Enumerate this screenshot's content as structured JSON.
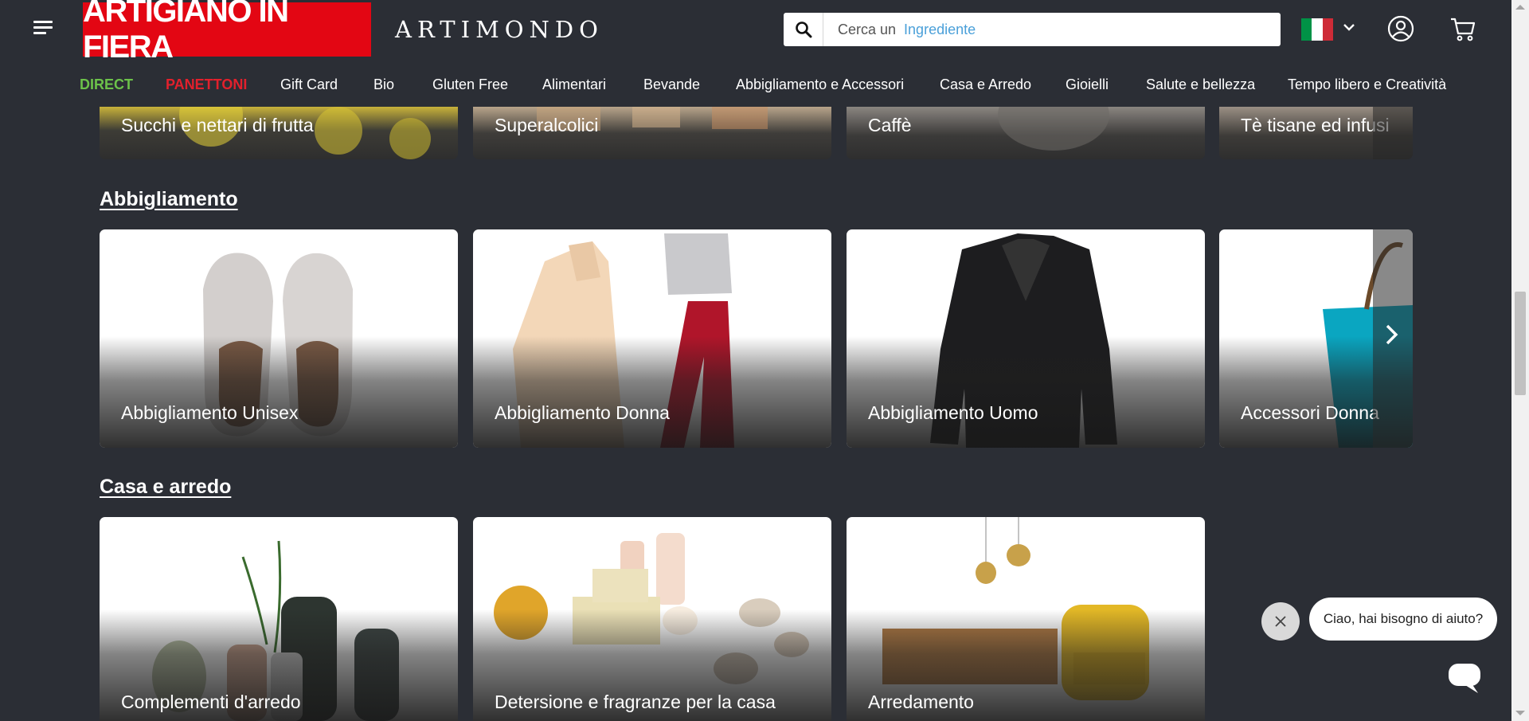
{
  "header": {
    "logo_text": "ARTIGIANO IN FIERA",
    "brand_text": "ARTIMONDO",
    "search": {
      "prefix": "Cerca un",
      "placeholder_word": "Ingrediente"
    },
    "flag_colors": [
      "#009246",
      "#ffffff",
      "#ce2b37"
    ]
  },
  "nav": {
    "items": [
      "DIRECT",
      "PANETTONI",
      "Gift Card",
      "Bio",
      "Gluten Free",
      "Alimentari",
      "Bevande",
      "Abbigliamento e Accessori",
      "Casa e Arredo",
      "Gioielli",
      "Salute e bellezza",
      "Tempo libero e Creatività"
    ]
  },
  "sections": {
    "top_cards": [
      "Succhi e nettari di frutta",
      "Superalcolici",
      "Caffè",
      "Tè tisane ed infusi"
    ],
    "abbigliamento": {
      "title": "Abbigliamento",
      "cards": [
        "Abbigliamento Unisex",
        "Abbigliamento Donna",
        "Abbigliamento Uomo",
        "Accessori Donna"
      ]
    },
    "casa": {
      "title": "Casa e arredo",
      "cards": [
        "Complementi d'arredo",
        "Detersione e fragranze per la casa",
        "Arredamento"
      ]
    }
  },
  "chat": {
    "message": "Ciao, hai bisogno di aiuto?"
  },
  "colors": {
    "brand_red": "#e30613",
    "direct_green": "#6cc24a",
    "panettoni_red": "#e3202c",
    "background": "#2b2e35",
    "link_blue": "#4ba0d9"
  }
}
